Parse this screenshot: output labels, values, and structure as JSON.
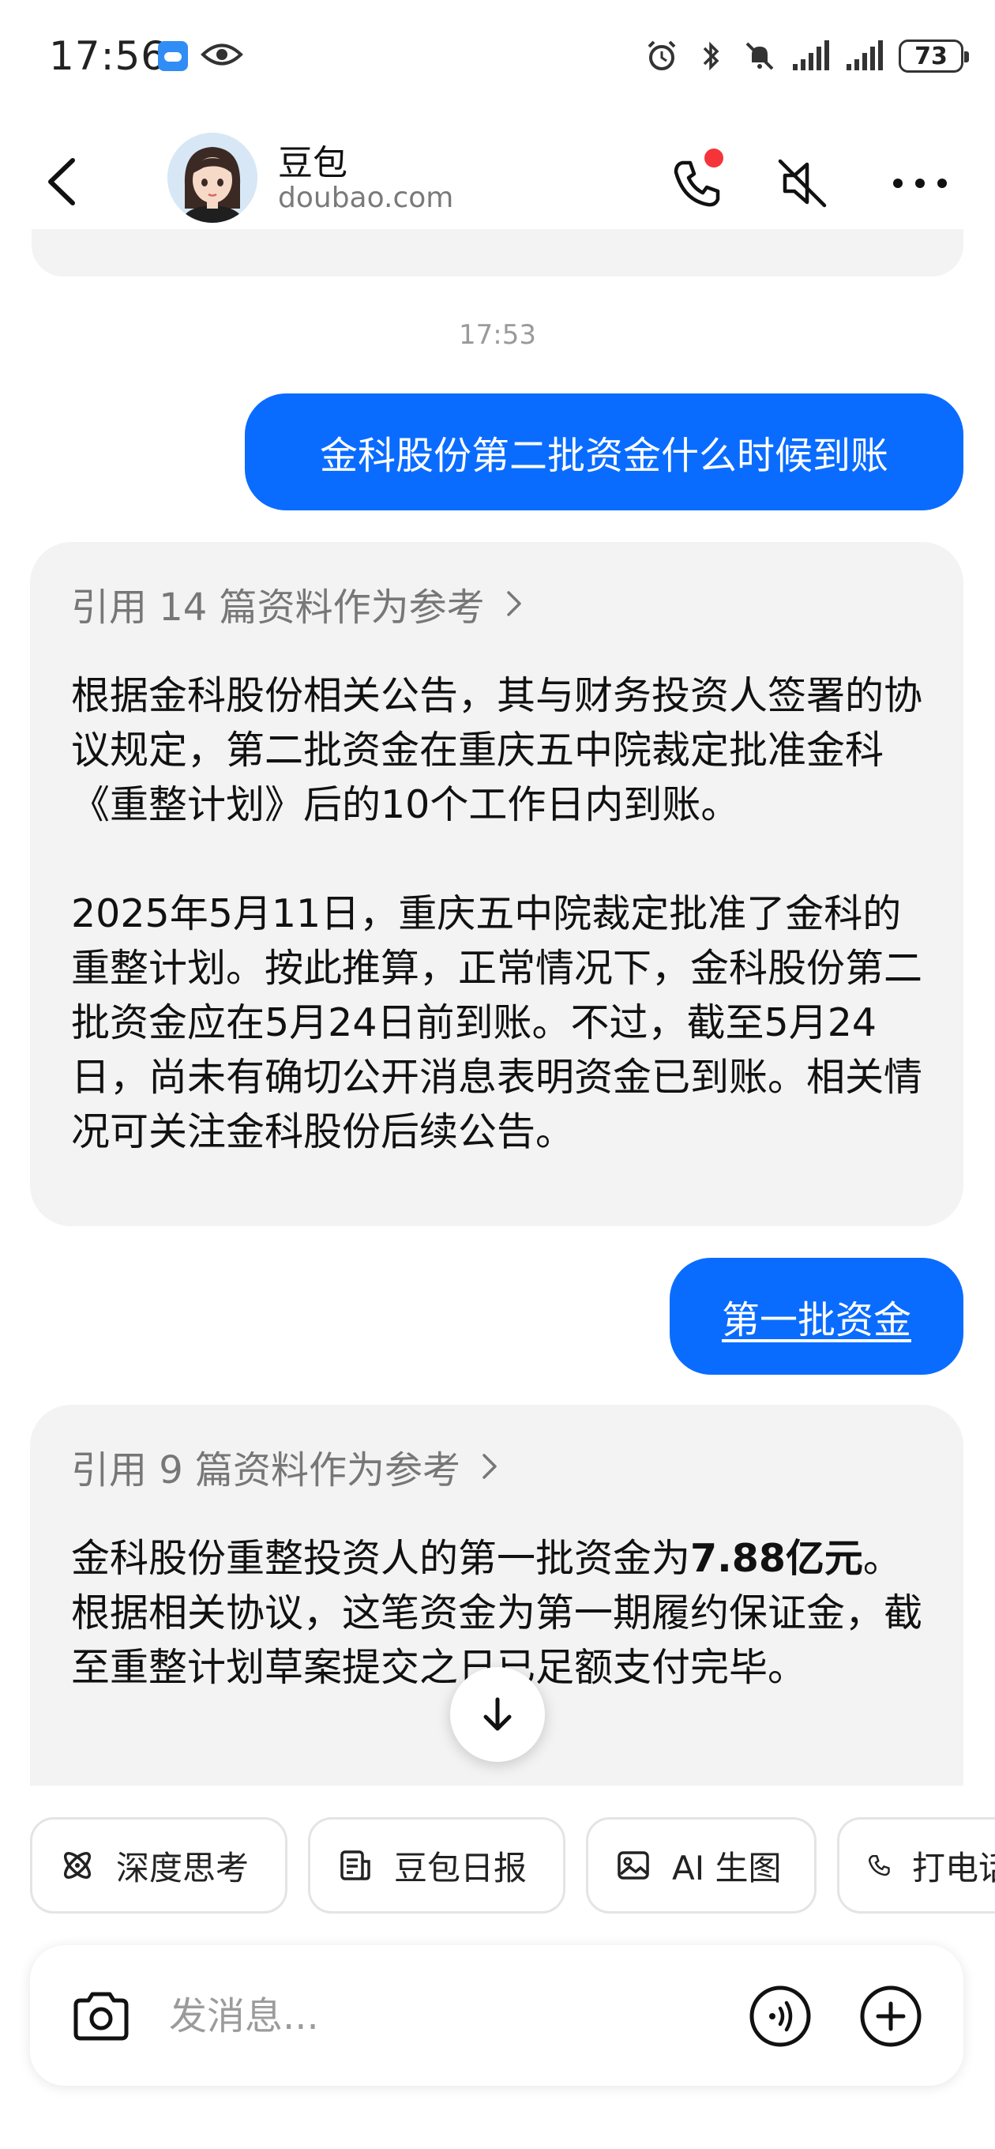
{
  "status_bar": {
    "time": "17:56",
    "battery": "73",
    "icons": [
      "weather-icon",
      "eye-icon",
      "alarm-icon",
      "bluetooth-icon",
      "mute-icon",
      "signal-icon",
      "signal-icon",
      "battery-icon"
    ]
  },
  "header": {
    "name": "豆包",
    "domain": "doubao.com",
    "icons": [
      "back-icon",
      "phone-icon",
      "speaker-off-icon",
      "more-icon"
    ]
  },
  "chat": {
    "timestamp": "17:53",
    "messages": [
      {
        "role": "user",
        "text": "金科股份第二批资金什么时候到账"
      },
      {
        "role": "bot",
        "citation": "引用 14 篇资料作为参考",
        "paragraphs": [
          "根据金科股份相关公告，其与财务投资人签署的协议规定，第二批资金在重庆五中院裁定批准金科《重整计划》后的10个工作日内到账。",
          "2025年5月11日，重庆五中院裁定批准了金科的重整计划。按此推算，正常情况下，金科股份第二批资金应在5月24日前到账。不过，截至5月24日，尚未有确切公开消息表明资金已到账。相关情况可关注金科股份后续公告。"
        ]
      },
      {
        "role": "user",
        "text": "第一批资金"
      },
      {
        "role": "bot",
        "citation": "引用 9 篇资料作为参考",
        "text_before": "金科股份重整投资人的第一批资金为",
        "text_bold": "7.88亿元",
        "text_after": "。根据相关协议，这笔资金为第一期履约保证金，截至重整计划草案提交之日已足额支付完毕。"
      }
    ]
  },
  "chips": [
    {
      "label": "深度思考",
      "icon": "atom-icon"
    },
    {
      "label": "豆包日报",
      "icon": "newspaper-icon"
    },
    {
      "label": "AI 生图",
      "icon": "image-icon"
    },
    {
      "label": "打电话",
      "icon": "phone-icon"
    }
  ],
  "input": {
    "placeholder": "发消息..."
  },
  "colors": {
    "accent": "#0a6cff",
    "bubble_bg": "#f3f3f3",
    "notification_dot": "#f5343a"
  }
}
